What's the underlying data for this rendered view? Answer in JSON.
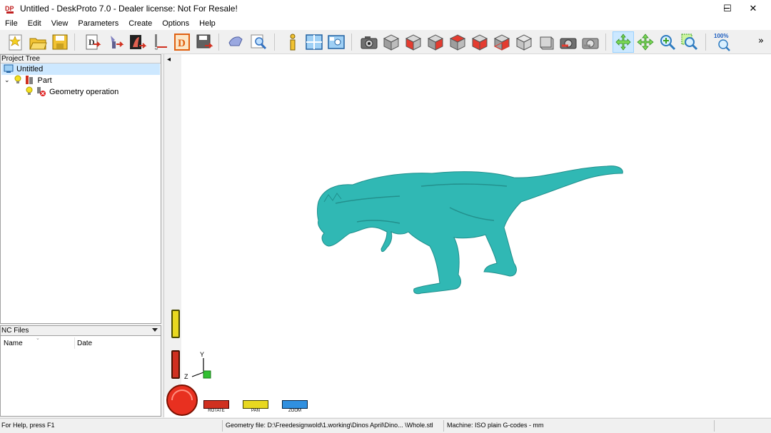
{
  "window": {
    "title": "Untitled - DeskProto 7.0 - Dealer license: Not For Resale!",
    "minimize_glyph": "─",
    "maximize_glyph": "☐",
    "close_glyph": "✕"
  },
  "menubar": {
    "items": [
      "File",
      "Edit",
      "View",
      "Parameters",
      "Create",
      "Options",
      "Help"
    ]
  },
  "toolbar": {
    "zoom_percent": "100%",
    "overflow_glyph": "»",
    "icons": [
      "new-project-icon",
      "open-icon",
      "save-icon",
      "import-geometry-icon",
      "part-parameters-icon",
      "operation-icon",
      "toolpath-icon",
      "nc-file-icon",
      "export-icon",
      "cut-icon",
      "zoom-region-icon",
      "info-icon",
      "window-layout-icon",
      "screen-icon",
      "camera-icon",
      "view-front-icon",
      "view-back-icon",
      "view-left-icon",
      "view-right-icon",
      "view-top-icon",
      "view-bottom-icon",
      "view-iso-icon",
      "view-box-icon",
      "camera-red-icon",
      "camera-gray-icon",
      "rotate-tool-icon",
      "pan-tool-icon",
      "zoom-tool-icon",
      "zoom-window-icon",
      "zoom-100-icon"
    ]
  },
  "project_tree": {
    "header": "Project Tree",
    "root": "Untitled",
    "part": "Part",
    "operation": "Geometry operation"
  },
  "nc_files": {
    "header": "NC Files",
    "columns": [
      "Name",
      "Date"
    ]
  },
  "viewport": {
    "model_color": "#30b8b4",
    "axes": {
      "y": "Y",
      "z": "Z"
    },
    "mouse_buttons": [
      "ROTATE",
      "PAN",
      "ZOOM"
    ],
    "collapse_glyph": "◂"
  },
  "statusbar": {
    "help": "For Help, press F1",
    "geometry": "Geometry file: D:\\Freedesignwold\\1.working\\Dinos April\\Dino... \\Whole.stl",
    "machine": "Machine: ISO plain G-codes - mm"
  },
  "colors": {
    "accent": "#cce8ff",
    "selection": "#cde8ff",
    "model": "#30b8b4"
  }
}
